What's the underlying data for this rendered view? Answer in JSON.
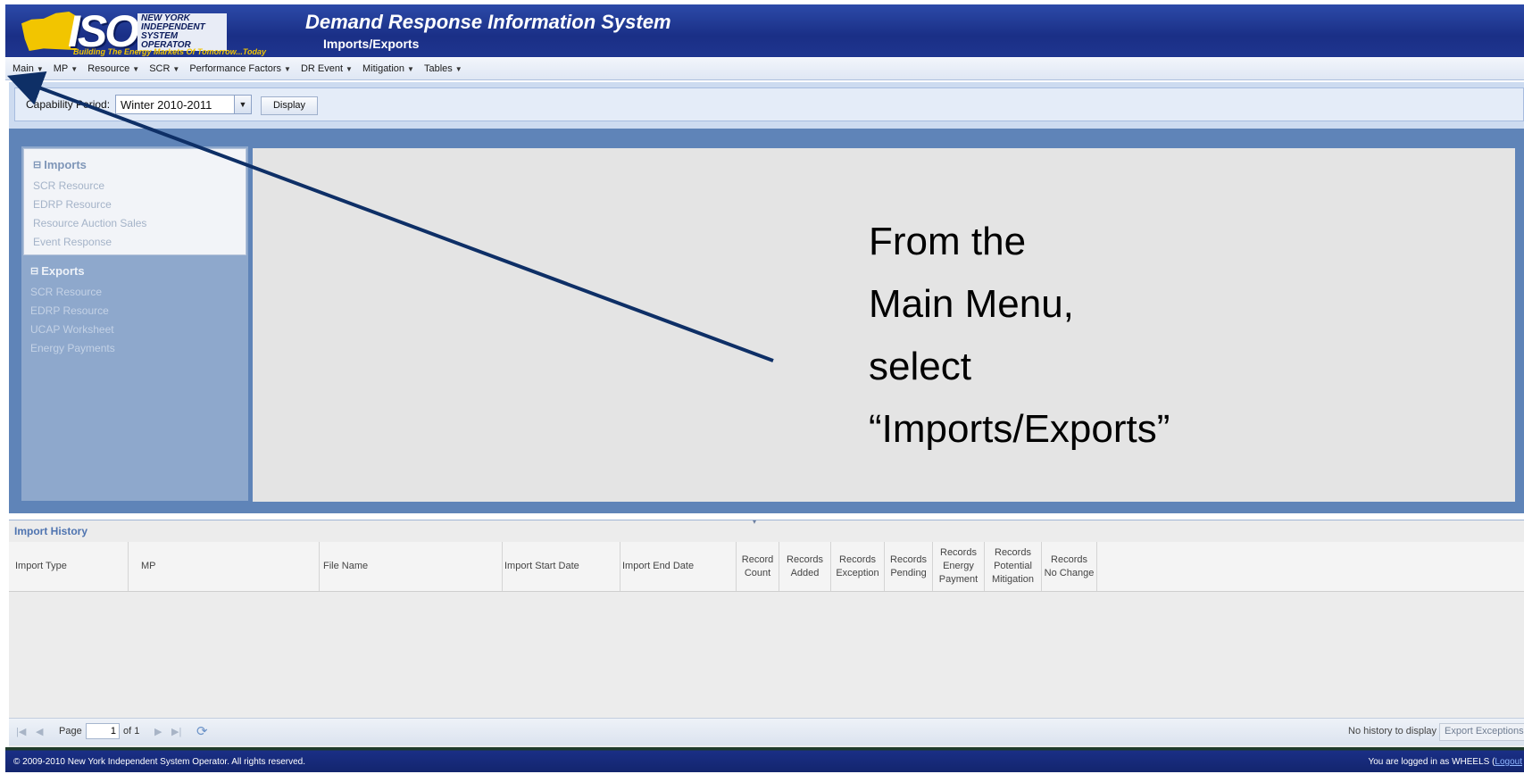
{
  "header": {
    "logo_text": "ISO",
    "logo_org": "NEW YORK\nINDEPENDENT\nSYSTEM OPERATOR",
    "logo_tagline": "Building The Energy Markets Of Tomorrow...Today",
    "app_title": "Demand Response Information System",
    "page_subtitle": "Imports/Exports"
  },
  "menu": [
    {
      "label": "Main"
    },
    {
      "label": "MP"
    },
    {
      "label": "Resource"
    },
    {
      "label": "SCR"
    },
    {
      "label": "Performance Factors"
    },
    {
      "label": "DR Event"
    },
    {
      "label": "Mitigation"
    },
    {
      "label": "Tables"
    }
  ],
  "toolbar": {
    "capability_label": "Capability Period:",
    "capability_value": "Winter 2010-2011",
    "display_label": "Display"
  },
  "nav": {
    "imports": {
      "heading": "Imports",
      "items": [
        "SCR Resource",
        "EDRP Resource",
        "Resource Auction Sales",
        "Event Response"
      ]
    },
    "exports": {
      "heading": "Exports",
      "items": [
        "SCR Resource",
        "EDRP Resource",
        "UCAP Worksheet",
        "Energy Payments"
      ]
    }
  },
  "annotation": {
    "lines": [
      "From the",
      "Main Menu,",
      "select",
      "“Imports/Exports”"
    ]
  },
  "history": {
    "title": "Import History",
    "columns": [
      "Import Type",
      "MP",
      "File Name",
      "Import Start Date",
      "Import End Date",
      "Record\nCount",
      "Records\nAdded",
      "Records\nException",
      "Records\nPending",
      "Records\nEnergy\nPayment",
      "Records\nPotential\nMitigation",
      "Records\nNo Change"
    ],
    "rows": [],
    "pager": {
      "page_label": "Page",
      "page_value": "1",
      "of_label": "of 1",
      "status": "No history to display",
      "export_label": "Export Exceptions"
    }
  },
  "footer": {
    "copyright": "© 2009-2010 New York Independent System Operator. All rights reserved.",
    "logged_in": "You are logged in as WHEELS (",
    "logout": "Logout"
  },
  "colors": {
    "header_blue": "#1a2f86",
    "panel_blue": "#5f84b8",
    "arrow": "#0e2f66",
    "logo_yellow": "#f2c500"
  }
}
